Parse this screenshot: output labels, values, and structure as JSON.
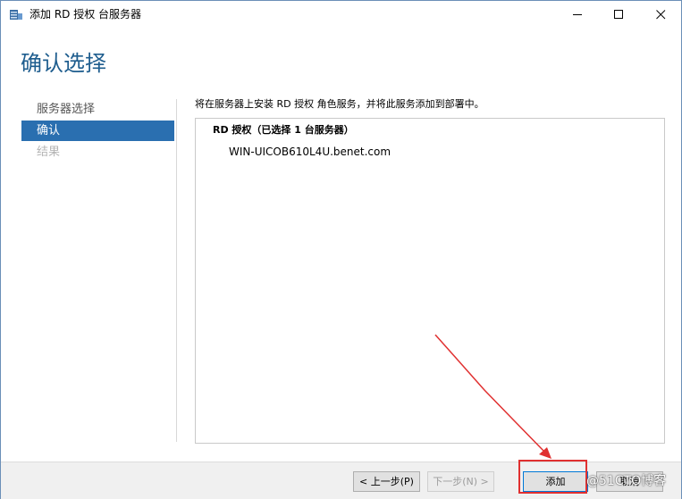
{
  "window": {
    "title": "添加 RD 授权 台服务器",
    "controls": {
      "minimize": "—",
      "maximize": "☐",
      "close": "✕"
    }
  },
  "page": {
    "heading": "确认选择"
  },
  "nav": {
    "items": [
      {
        "label": "服务器选择",
        "state": "normal"
      },
      {
        "label": "确认",
        "state": "active"
      },
      {
        "label": "结果",
        "state": "disabled"
      }
    ]
  },
  "content": {
    "description": "将在服务器上安装 RD 授权 角色服务，并将此服务添加到部署中。",
    "section_heading": "RD 授权（已选择 1 台服务器）",
    "server_name": "WIN-UICOB610L4U.benet.com"
  },
  "footer": {
    "prev_label": "< 上一步(P)",
    "next_label": "下一步(N) >",
    "add_label": "添加",
    "cancel_label": "取消"
  },
  "watermark": "@51CTO博客",
  "colors": {
    "accent": "#2a6fb0",
    "heading": "#1e5d8e",
    "annotation": "#e03030"
  },
  "icons": {
    "app": "server-manager-icon"
  }
}
